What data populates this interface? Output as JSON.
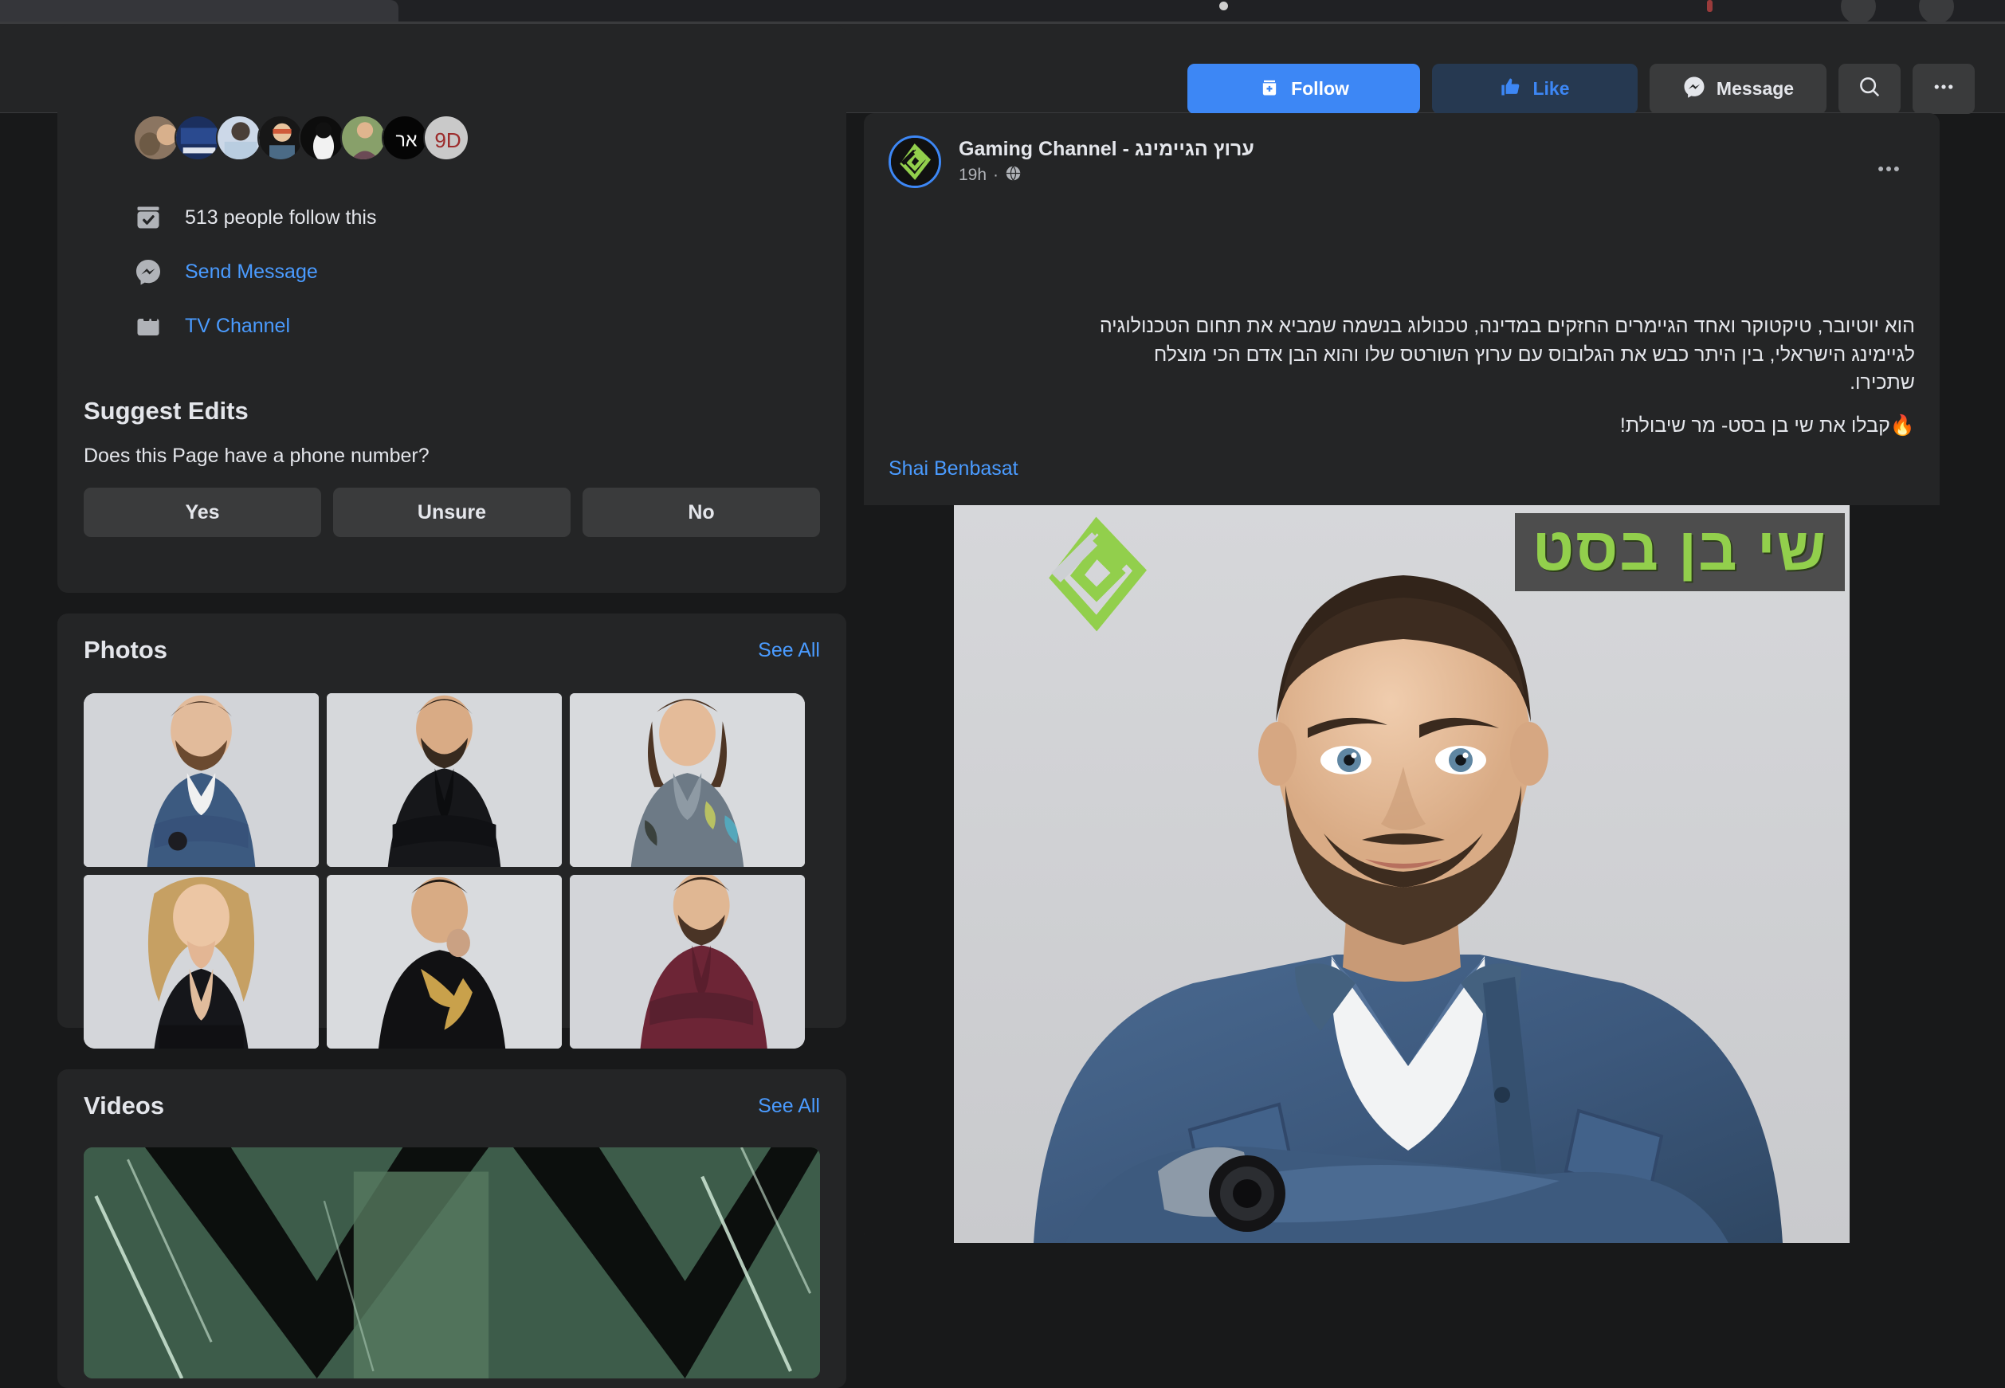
{
  "browser": {
    "tab_title": ""
  },
  "header": {
    "page_name": "Gaming Channel - ערוץ הגיימינג",
    "avatar_icon": "gaming-channel-logo",
    "actions": {
      "follow_label": "Follow",
      "follow_icon": "follow-plus-icon",
      "like_label": "Like",
      "like_icon": "thumbs-up-icon",
      "message_label": "Message",
      "message_icon": "messenger-icon",
      "search_icon": "search-icon",
      "more_icon": "ellipsis-icon"
    },
    "colors": {
      "follow_bg": "#3d87f5",
      "like_bg": "#263951",
      "like_fg": "#3d87f5",
      "neutral_bg": "#3a3b3c",
      "card_bg": "#242526",
      "page_bg": "#18191a",
      "link": "#4a9bff",
      "brand_green": "#92cf4c"
    }
  },
  "sidebar": {
    "intro": {
      "follower_count_text": "513 people follow this",
      "follower_icon": "followers-check-icon",
      "send_message_label": "Send Message",
      "send_message_icon": "messenger-icon",
      "tv_channel_label": "TV Channel",
      "tv_channel_icon": "tv-category-icon",
      "avatar_count": 8
    },
    "suggest_edits": {
      "title": "Suggest Edits",
      "question": "Does this Page have a phone number?",
      "buttons": [
        "Yes",
        "Unsure",
        "No"
      ]
    },
    "photos": {
      "title": "Photos",
      "see_all_label": "See All",
      "thumbnails": [
        {
          "name": "photo-denim-shirt-man",
          "skin": "#e2bb9b",
          "hair": "#4a3323",
          "shirt": "#3c5a80",
          "bg": "#d2d4d8"
        },
        {
          "name": "photo-black-shirt-man",
          "skin": "#d9ab85",
          "hair": "#2a2018",
          "shirt": "#16171a",
          "bg": "#d6d8db"
        },
        {
          "name": "photo-floral-shirt-woman",
          "skin": "#e4bb99",
          "hair": "#4d3524",
          "shirt": "#6d7a86",
          "bg": "#d8dadd"
        },
        {
          "name": "photo-blonde-woman",
          "skin": "#ecc6a4",
          "hair": "#c6a063",
          "shirt": "#15161a",
          "bg": "#d4d6da"
        },
        {
          "name": "photo-hoodie-man",
          "skin": "#d8ab84",
          "hair": "#221a14",
          "shirt": "#111113",
          "bg": "#d9dbde"
        },
        {
          "name": "photo-maroon-shirt-man",
          "skin": "#e0b793",
          "hair": "#38281c",
          "shirt": "#6d2536",
          "bg": "#d3d5d9"
        }
      ]
    },
    "videos": {
      "title": "Videos",
      "see_all_label": "See All",
      "thumbnail_name": "video-thumbnail-green-glitch"
    }
  },
  "post": {
    "author": "Gaming Channel - ערוץ הגיימינג",
    "time": "19h",
    "privacy_icon": "globe-icon",
    "menu_icon": "ellipsis-icon",
    "body_line1": "הוא יוטיובר, טיקטוקר ואחד הגיימרים החזקים במדינה, טכנולוג בנשמה שמביא את תחום הטכנולוגיה",
    "body_line2": "לגיימינג הישראלי, בין היתר כבש את הגלובוס עם ערוץ השורטס שלו והוא הבן אדם הכי מוצלח",
    "body_line3": "שתכירו.",
    "cta_text": "🔥קבלו את שי בן בסט- מר שיבולת!",
    "tagged_person": "Shai Benbasat",
    "media": {
      "banner_text": "שי בן בסט",
      "logo_name": "gaming-channel-logo",
      "subject_name": "shai-benbasat-portrait"
    }
  }
}
